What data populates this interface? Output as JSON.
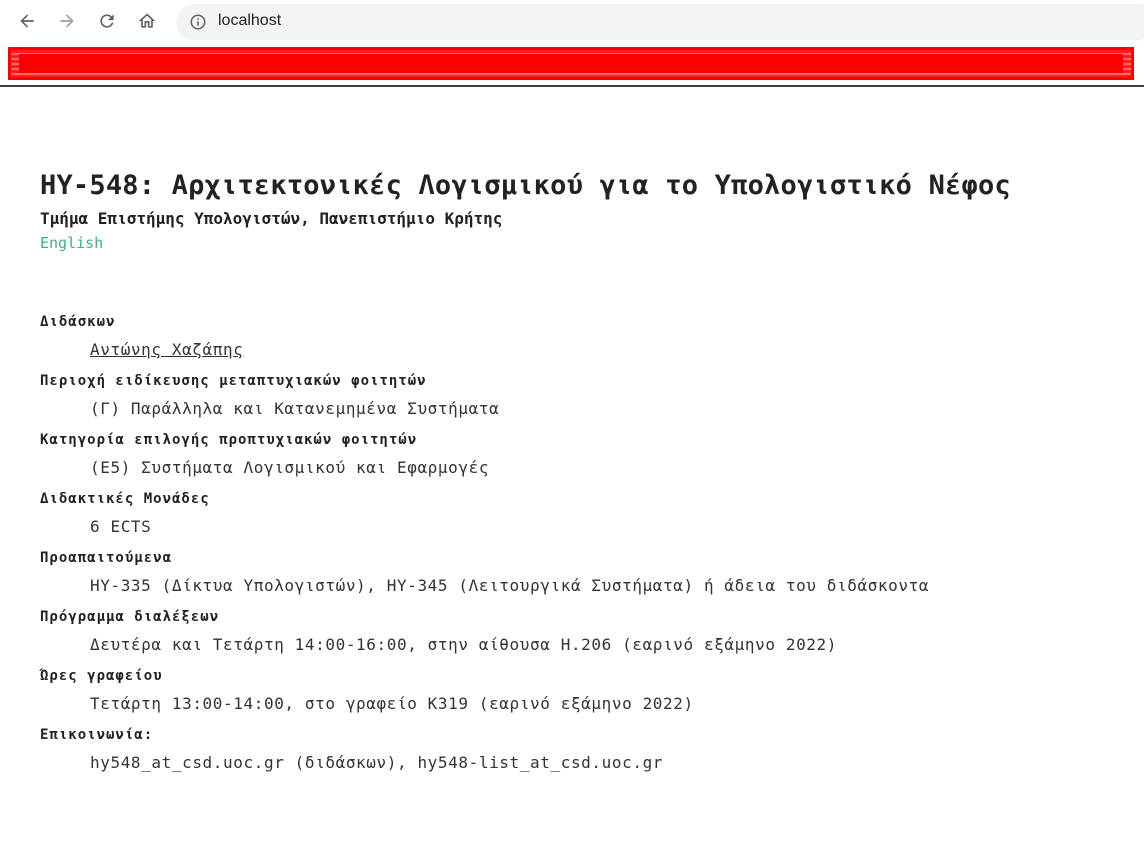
{
  "browser": {
    "url": "localhost",
    "icons": {
      "back": "arrow-back-icon",
      "forward": "arrow-forward-icon",
      "reload": "reload-icon",
      "home": "home-icon",
      "site_info": "info-icon"
    }
  },
  "page": {
    "title": "HY-548: Αρχιτεκτονικές Λογισμικού για το Υπολογιστικό Νέφος",
    "subtitle": "Τμήμα Επιστήμης Υπολογιστών, Πανεπιστήμιο Κρήτης",
    "language_link": "English",
    "colors": {
      "link": "#3fb37a",
      "redaction": "#ff0000"
    },
    "info": [
      {
        "label": "Διδάσκων",
        "value": "Αντώνης Χαζάπης"
      },
      {
        "label": "Περιοχή ειδίκευσης μεταπτυχιακών φοιτητών",
        "value": "(Γ) Παράλληλα και Κατανεμημένα Συστήματα"
      },
      {
        "label": "Κατηγορία επιλογής προπτυχιακών φοιτητών",
        "value": "(Ε5) Συστήματα Λογισμικού και Εφαρμογές"
      },
      {
        "label": "Διδακτικές Μονάδες",
        "value": "6 ECTS"
      },
      {
        "label": "Προαπαιτούμενα",
        "value": "HY-335 (Δίκτυα Υπολογιστών), HY-345 (Λειτουργικά Συστήματα) ή άδεια του διδάσκοντα"
      },
      {
        "label": "Πρόγραμμα διαλέξεων",
        "value": "Δευτέρα και Τετάρτη 14:00-16:00, στην αίθουσα Η.206 (εαρινό εξάμηνο 2022)"
      },
      {
        "label": "Ώρες γραφείου",
        "value": "Τετάρτη 13:00-14:00, στο γραφείο Κ319 (εαρινό εξάμηνο 2022)"
      },
      {
        "label": "Επικοινωνία:",
        "value": "hy548_at_csd.uoc.gr (διδάσκων), hy548-list_at_csd.uoc.gr"
      }
    ]
  }
}
